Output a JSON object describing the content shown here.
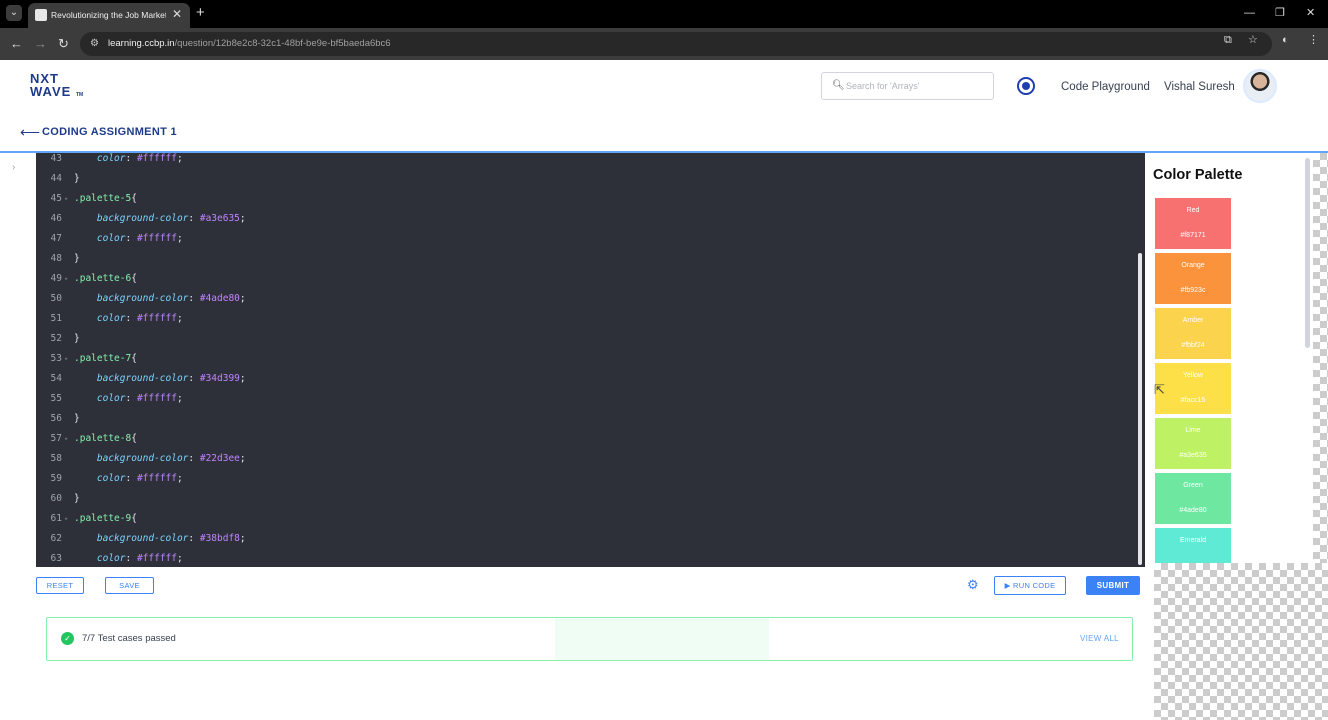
{
  "browser": {
    "tab_title": "Revolutionizing the Job Market",
    "new_tab_icon": "+",
    "url_host": "learning.ccbp.in",
    "url_path": "/question/12b8e2c8-32c1-48bf-be9e-bf5baeda6bc6"
  },
  "header": {
    "logo_top": "NXT",
    "logo_bottom": "WAVE",
    "logo_tm": "TM",
    "search_placeholder": "Search for 'Arrays'",
    "code_playground": "Code Playground",
    "user_name": "Vishal Suresh"
  },
  "assignment": {
    "title": "CODING ASSIGNMENT 1"
  },
  "editor": {
    "lines": [
      {
        "n": "43",
        "fold": "",
        "parts": [
          {
            "c": "sp",
            "t": "    "
          },
          {
            "c": "prop",
            "t": "color"
          },
          {
            "c": "p",
            "t": ": "
          },
          {
            "c": "val",
            "t": "#ffffff"
          },
          {
            "c": "p",
            "t": ";"
          }
        ]
      },
      {
        "n": "44",
        "fold": "",
        "parts": [
          {
            "c": "p",
            "t": "}"
          }
        ]
      },
      {
        "n": "45",
        "fold": "▾",
        "parts": [
          {
            "c": "sel",
            "t": ".palette-5"
          },
          {
            "c": "p",
            "t": "{"
          }
        ]
      },
      {
        "n": "46",
        "fold": "",
        "parts": [
          {
            "c": "sp",
            "t": "    "
          },
          {
            "c": "prop",
            "t": "background-color"
          },
          {
            "c": "p",
            "t": ": "
          },
          {
            "c": "val",
            "t": "#a3e635"
          },
          {
            "c": "p",
            "t": ";"
          }
        ]
      },
      {
        "n": "47",
        "fold": "",
        "parts": [
          {
            "c": "sp",
            "t": "    "
          },
          {
            "c": "prop",
            "t": "color"
          },
          {
            "c": "p",
            "t": ": "
          },
          {
            "c": "val",
            "t": "#ffffff"
          },
          {
            "c": "p",
            "t": ";"
          }
        ]
      },
      {
        "n": "48",
        "fold": "",
        "parts": [
          {
            "c": "p",
            "t": "}"
          }
        ]
      },
      {
        "n": "49",
        "fold": "▾",
        "parts": [
          {
            "c": "sel",
            "t": ".palette-6"
          },
          {
            "c": "p",
            "t": "{"
          }
        ]
      },
      {
        "n": "50",
        "fold": "",
        "parts": [
          {
            "c": "sp",
            "t": "    "
          },
          {
            "c": "prop",
            "t": "background-color"
          },
          {
            "c": "p",
            "t": ": "
          },
          {
            "c": "val",
            "t": "#4ade80"
          },
          {
            "c": "p",
            "t": ";"
          }
        ]
      },
      {
        "n": "51",
        "fold": "",
        "parts": [
          {
            "c": "sp",
            "t": "    "
          },
          {
            "c": "prop",
            "t": "color"
          },
          {
            "c": "p",
            "t": ": "
          },
          {
            "c": "val",
            "t": "#ffffff"
          },
          {
            "c": "p",
            "t": ";"
          }
        ]
      },
      {
        "n": "52",
        "fold": "",
        "parts": [
          {
            "c": "p",
            "t": "}"
          }
        ]
      },
      {
        "n": "53",
        "fold": "▾",
        "parts": [
          {
            "c": "sel",
            "t": ".palette-7"
          },
          {
            "c": "p",
            "t": "{"
          }
        ]
      },
      {
        "n": "54",
        "fold": "",
        "parts": [
          {
            "c": "sp",
            "t": "    "
          },
          {
            "c": "prop",
            "t": "background-color"
          },
          {
            "c": "p",
            "t": ": "
          },
          {
            "c": "val",
            "t": "#34d399"
          },
          {
            "c": "p",
            "t": ";"
          }
        ]
      },
      {
        "n": "55",
        "fold": "",
        "parts": [
          {
            "c": "sp",
            "t": "    "
          },
          {
            "c": "prop",
            "t": "color"
          },
          {
            "c": "p",
            "t": ": "
          },
          {
            "c": "val",
            "t": "#ffffff"
          },
          {
            "c": "p",
            "t": ";"
          }
        ]
      },
      {
        "n": "56",
        "fold": "",
        "parts": [
          {
            "c": "p",
            "t": "}"
          }
        ]
      },
      {
        "n": "57",
        "fold": "▾",
        "parts": [
          {
            "c": "sel",
            "t": ".palette-8"
          },
          {
            "c": "p",
            "t": "{"
          }
        ]
      },
      {
        "n": "58",
        "fold": "",
        "parts": [
          {
            "c": "sp",
            "t": "    "
          },
          {
            "c": "prop",
            "t": "background-color"
          },
          {
            "c": "p",
            "t": ": "
          },
          {
            "c": "val",
            "t": "#22d3ee"
          },
          {
            "c": "p",
            "t": ";"
          }
        ]
      },
      {
        "n": "59",
        "fold": "",
        "parts": [
          {
            "c": "sp",
            "t": "    "
          },
          {
            "c": "prop",
            "t": "color"
          },
          {
            "c": "p",
            "t": ": "
          },
          {
            "c": "val",
            "t": "#ffffff"
          },
          {
            "c": "p",
            "t": ";"
          }
        ]
      },
      {
        "n": "60",
        "fold": "",
        "parts": [
          {
            "c": "p",
            "t": "}"
          }
        ]
      },
      {
        "n": "61",
        "fold": "▾",
        "parts": [
          {
            "c": "sel",
            "t": ".palette-9"
          },
          {
            "c": "p",
            "t": "{"
          }
        ]
      },
      {
        "n": "62",
        "fold": "",
        "parts": [
          {
            "c": "sp",
            "t": "    "
          },
          {
            "c": "prop",
            "t": "background-color"
          },
          {
            "c": "p",
            "t": ": "
          },
          {
            "c": "val",
            "t": "#38bdf8"
          },
          {
            "c": "p",
            "t": ";"
          }
        ]
      },
      {
        "n": "63",
        "fold": "",
        "parts": [
          {
            "c": "sp",
            "t": "    "
          },
          {
            "c": "prop",
            "t": "color"
          },
          {
            "c": "p",
            "t": ": "
          },
          {
            "c": "val",
            "t": "#ffffff"
          },
          {
            "c": "p",
            "t": ";"
          }
        ]
      }
    ]
  },
  "preview": {
    "title": "Color Palette",
    "swatches": [
      {
        "name": "Red",
        "code": "#f87171",
        "color": "#f87171"
      },
      {
        "name": "Orange",
        "code": "#fb923c",
        "color": "#fb923c"
      },
      {
        "name": "Amber",
        "code": "#fbbf24",
        "color": "#fcd34d"
      },
      {
        "name": "Yellow",
        "code": "#facc15",
        "color": "#fde047"
      },
      {
        "name": "Lime",
        "code": "#a3e635",
        "color": "#bef264"
      },
      {
        "name": "Green",
        "code": "#4ade80",
        "color": "#6ee7a0"
      },
      {
        "name": "Emerald",
        "code": "",
        "color": "#5eead4"
      }
    ]
  },
  "actions": {
    "reset": "RESET",
    "save": "SAVE",
    "run_code": "RUN CODE",
    "submit": "SUBMIT"
  },
  "result": {
    "text": "7/7 Test cases passed",
    "view_all": "VIEW ALL"
  },
  "colors": {
    "accent": "#3b82f6",
    "brand": "#1e3a8a",
    "success": "#22c55e",
    "editor_bg": "#2d3039"
  }
}
